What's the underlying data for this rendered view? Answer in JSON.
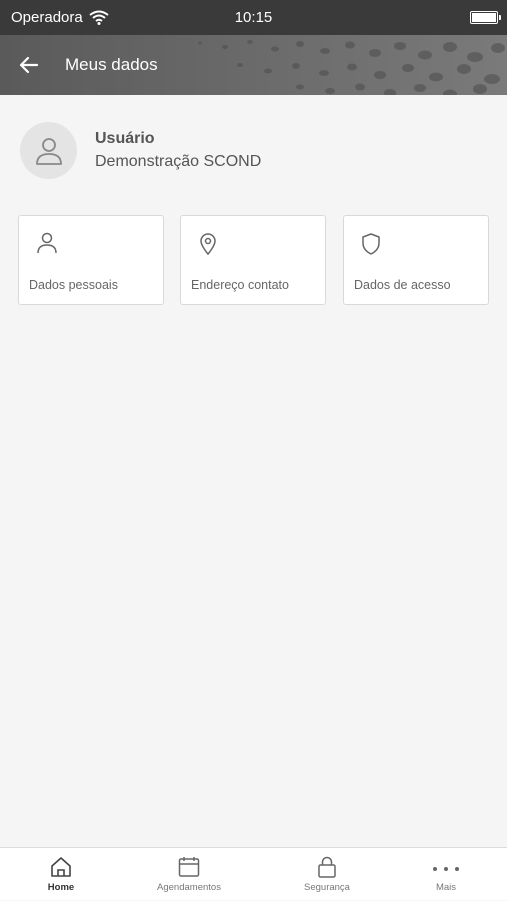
{
  "status_bar": {
    "carrier": "Operadora",
    "time": "10:15"
  },
  "header": {
    "title": "Meus dados"
  },
  "profile": {
    "label": "Usuário",
    "name": "Demonstração SCOND"
  },
  "cards": [
    {
      "label": "Dados pessoais",
      "icon": "person-icon"
    },
    {
      "label": "Endereço contato",
      "icon": "location-pin-icon"
    },
    {
      "label": "Dados de acesso",
      "icon": "shield-icon"
    }
  ],
  "tabs": [
    {
      "label": "Home",
      "icon": "home-icon",
      "active": true
    },
    {
      "label": "Agendamentos",
      "icon": "calendar-icon",
      "active": false
    },
    {
      "label": "Segurança",
      "icon": "lock-icon",
      "active": false
    },
    {
      "label": "Mais",
      "icon": "more-dots-icon",
      "active": false
    }
  ],
  "colors": {
    "header_bg": "#666666",
    "status_bg": "#3a3a3a",
    "page_bg": "#f5f5f5",
    "card_border": "#d9d9d9"
  }
}
